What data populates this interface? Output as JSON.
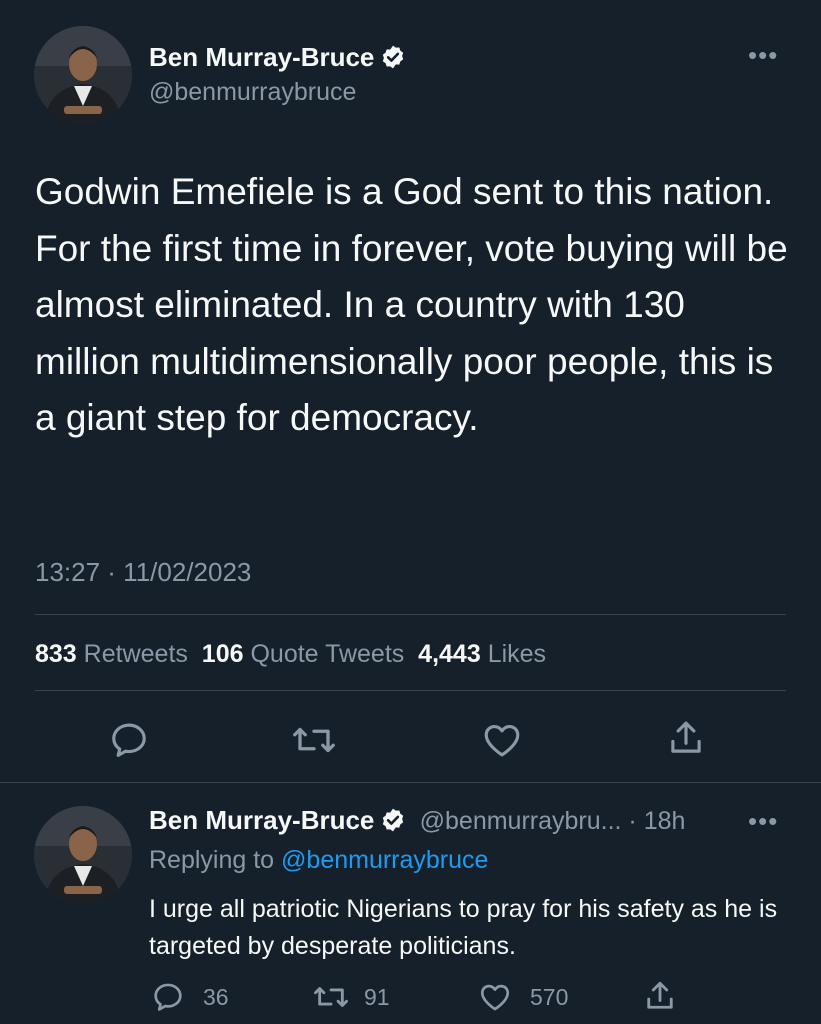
{
  "main_tweet": {
    "author_name": "Ben Murray-Bruce",
    "author_handle": "@benmurraybruce",
    "text": "Godwin Emefiele is a God sent to this nation. For the first time in forever, vote buying will be almost eliminated. In a country with 130 million multidimensionally poor people, this is a giant step for democracy.",
    "timestamp": "13:27 · 11/02/2023",
    "stats": {
      "retweets_count": "833",
      "retweets_label": "Retweets",
      "quotes_count": "106",
      "quotes_label": "Quote Tweets",
      "likes_count": "4,443",
      "likes_label": "Likes"
    },
    "more_label": "•••"
  },
  "reply_tweet": {
    "author_name": "Ben Murray-Bruce",
    "author_handle_time": "@benmurraybru... · 18h",
    "replying_prefix": "Replying to ",
    "replying_handle": "@benmurraybruce",
    "text": "I urge all patriotic Nigerians to pray for his safety as he is targeted by desperate politicians.",
    "reply_count": "36",
    "retweet_count": "91",
    "like_count": "570",
    "more_label": "•••"
  },
  "icons": {
    "verified": "verified-badge-icon",
    "reply": "speech-bubble-icon",
    "retweet": "retweet-arrows-icon",
    "like": "heart-icon",
    "share": "share-upload-icon"
  },
  "colors": {
    "background": "#15202b",
    "text": "#f7f9f9",
    "secondary_text": "#8b98a5",
    "accent": "#1d9bf0",
    "divider": "#38444d"
  }
}
